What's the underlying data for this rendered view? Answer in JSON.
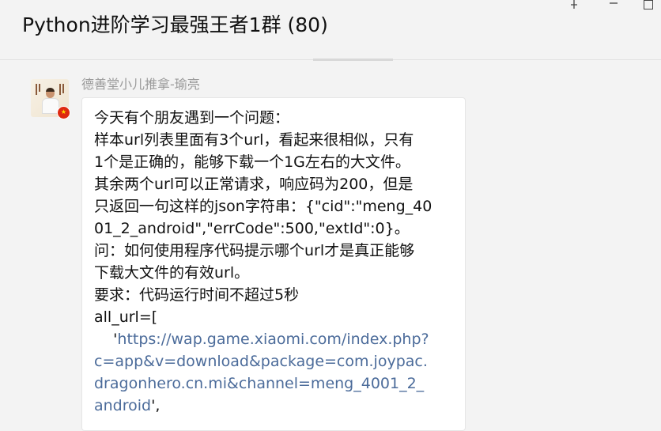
{
  "window": {
    "title": "Python进阶学习最强王者1群 (80)",
    "controls": {
      "pin": "pin-icon",
      "minimize": "minimize-icon",
      "restore": "restore-icon"
    }
  },
  "message": {
    "sender": "德善堂小儿推拿-瑜亮",
    "avatar_icon": "user-avatar-icon",
    "badge_icon": "china-flag-icon",
    "lines": [
      "今天有个朋友遇到一个问题：",
      "样本url列表里面有3个url，看起来很相似，只有",
      "1个是正确的，能够下载一个1G左右的大文件。",
      "其余两个url可以正常请求，响应码为200，但是",
      "只返回一句这样的json字符串：{\"cid\":\"meng_40",
      "01_2_android\",\"errCode\":500,\"extId\":0}。",
      "问：如何使用程序代码提示哪个url才是真正能够",
      "下载大文件的有效url。",
      "要求：代码运行时间不超过5秒",
      "all_url=["
    ],
    "url_lines": [
      "'https://wap.game.xiaomi.com/index.php?",
      "c=app&v=download&package=com.joypac.",
      "dragonhero.cn.mi&channel=meng_4001_2_",
      "android',"
    ]
  },
  "colors": {
    "background": "#f3f3f3",
    "bubble": "#ffffff",
    "link": "#4b6b9a",
    "sender": "#9a9a9a"
  }
}
